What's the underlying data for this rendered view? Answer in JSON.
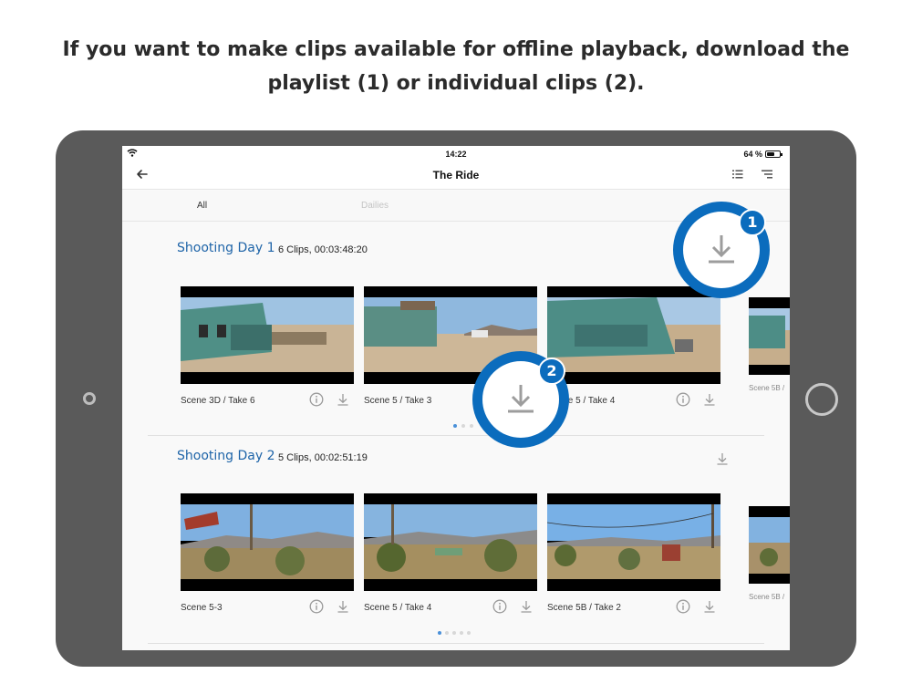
{
  "headline": {
    "line1": "If you want to make clips available for offline playback, download the",
    "line2": "playlist (1) or individual clips (2)."
  },
  "status_bar": {
    "time": "14:22",
    "battery": "64 %",
    "battery_level": 0.64
  },
  "nav": {
    "title": "The Ride",
    "back_icon": "arrow-left-icon",
    "list_icon": "list-icon",
    "sort_icon": "sort-icon"
  },
  "tabs": [
    {
      "label": "All",
      "selected": true
    },
    {
      "label": "Dailies",
      "selected": false
    }
  ],
  "sections": [
    {
      "title": "Shooting Day 1",
      "info": "6 Clips, 00:03:48:20",
      "clips": [
        {
          "label": "Scene 3D  / Take 6"
        },
        {
          "label": "Scene 5  / Take 3"
        },
        {
          "label": "Scene 5  / Take 4"
        }
      ],
      "partial_clip_label": "Scene 5B  /",
      "pages": 3,
      "active_page": 0
    },
    {
      "title": "Shooting Day 2",
      "info": "5 Clips, 00:02:51:19",
      "clips": [
        {
          "label": "Scene 5-3"
        },
        {
          "label": "Scene 5  / Take 4"
        },
        {
          "label": "Scene 5B  / Take 2"
        }
      ],
      "partial_clip_label": "Scene 5B  /",
      "pages": 5,
      "active_page": 0
    }
  ],
  "callouts": [
    {
      "number": "1",
      "icon": "download-icon"
    },
    {
      "number": "2",
      "icon": "download-icon"
    }
  ],
  "colors": {
    "accent": "#0b6cbd",
    "section_title": "#1e64a8",
    "device": "#5a5a5a"
  }
}
